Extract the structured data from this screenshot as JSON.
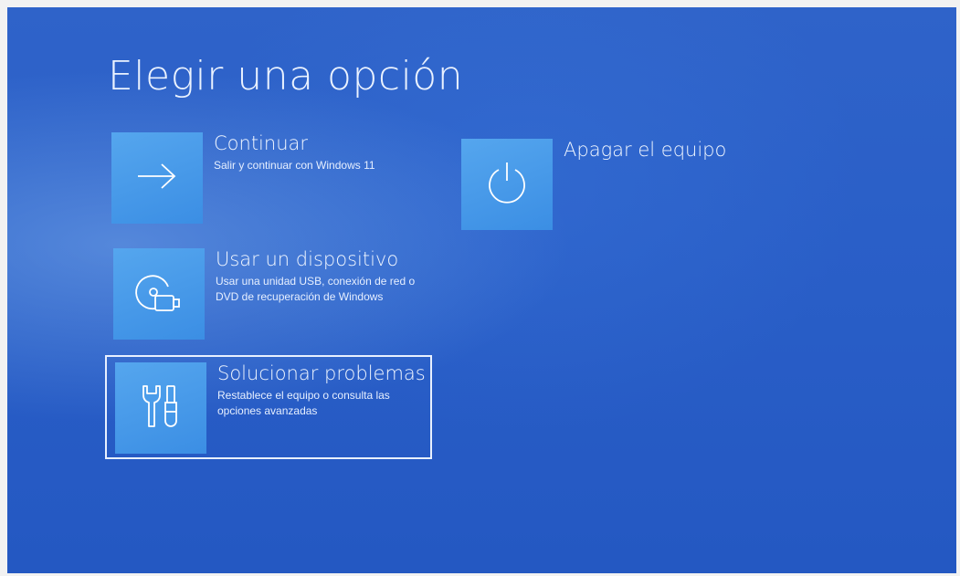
{
  "page_title": "Elegir una opción",
  "options": [
    {
      "title": "Continuar",
      "description": "Salir y continuar con Windows 11",
      "icon": "arrow-right-icon"
    },
    {
      "title": "Apagar el equipo",
      "description": "",
      "icon": "power-icon"
    },
    {
      "title": "Usar un dispositivo",
      "description": "Usar una unidad USB, conexión de red o DVD de recuperación de Windows",
      "icon": "disc-usb-icon"
    },
    {
      "title": "Solucionar problemas",
      "description": "Restablece el equipo o consulta las opciones avanzadas",
      "icon": "tools-icon",
      "selected": true
    }
  ],
  "colors": {
    "background": "#2a5fc8",
    "tile": "#4a9be9",
    "text": "#f0f6ff"
  }
}
